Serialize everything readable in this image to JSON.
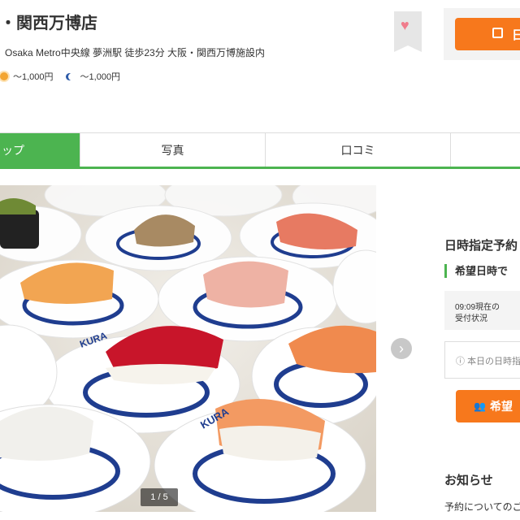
{
  "header": {
    "title": "・関西万博店",
    "access": "Osaka Metro中央線 夢洲駅 徒歩23分 大阪・関西万博施設内",
    "lunch_price": "～1,000円",
    "dinner_price": "～1,000円",
    "reserve_label": "日"
  },
  "tabs": [
    {
      "label": "ップ",
      "active": true
    },
    {
      "label": "写真",
      "active": false
    },
    {
      "label": "口コミ",
      "active": false
    },
    {
      "label": "",
      "active": false
    }
  ],
  "gallery": {
    "counter": "1 / 5",
    "plate_text": "KURA"
  },
  "side": {
    "title": "日時指定予約",
    "subtitle": "希望日時で",
    "status_time": "09:09現在の",
    "status_label": "受付状況",
    "today_text": "本日の日時指",
    "want_label": "希望",
    "notice_title": "お知らせ",
    "notice_text": "予約についてのご"
  },
  "colors": {
    "accent_green": "#4cb450",
    "accent_orange": "#f7781c",
    "heart": "#f07c8c"
  }
}
